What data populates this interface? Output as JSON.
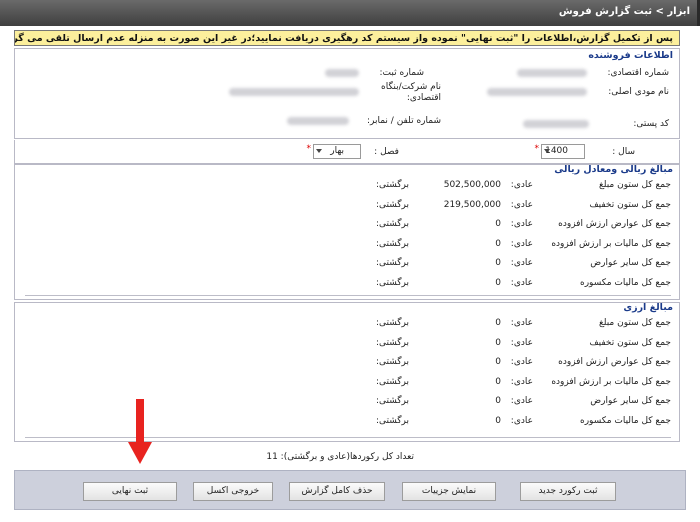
{
  "breadcrumb": "ابزار > ثبت گزارش فروش",
  "notice": "پس از تکمیل گزارش،اطلاعات را \"ثبت نهایی\" نموده واز سیستم کد رهگیری دریافت نمایید؛در غیر این صورت به منزله عدم ارسال تلقی می گردد!",
  "seller": {
    "title": "اطلاعات فروشنده",
    "economic_code_label": "شماره اقتصادی:",
    "reg_no_label": "شماره ثبت:",
    "taxpayer_name_label": "نام مودی اصلی:",
    "company_name_label": "نام شرکت/بنگاه اقتصادی:",
    "postal_code_label": "کد پستی:",
    "phone_label": "شماره تلفن / نمابر:"
  },
  "filters": {
    "year_label": "سال :",
    "year_value": "1400",
    "season_label": "فصل :",
    "season_value": "بهار"
  },
  "rial": {
    "title": "مبالغ ریالی ومعادل ریالی",
    "rows": [
      {
        "label": "جمع کل ستون مبلغ",
        "adi": "عادی:",
        "value": "502,500,000",
        "ret": "برگشتی:"
      },
      {
        "label": "جمع کل ستون تخفیف",
        "adi": "عادی:",
        "value": "219,500,000",
        "ret": "برگشتی:"
      },
      {
        "label": "جمع کل عوارض ارزش افزوده",
        "adi": "عادی:",
        "value": "0",
        "ret": "برگشتی:"
      },
      {
        "label": "جمع کل مالیات بر ارزش افزوده",
        "adi": "عادی:",
        "value": "0",
        "ret": "برگشتی:"
      },
      {
        "label": "جمع کل سایر عوارض",
        "adi": "عادی:",
        "value": "0",
        "ret": "برگشتی:"
      },
      {
        "label": "جمع کل مالیات مکسوره",
        "adi": "عادی:",
        "value": "0",
        "ret": "برگشتی:"
      }
    ]
  },
  "currency": {
    "title": "مبالغ ارزی",
    "rows": [
      {
        "label": "جمع کل ستون مبلغ",
        "adi": "عادی:",
        "value": "0",
        "ret": "برگشتی:"
      },
      {
        "label": "جمع کل ستون تخفیف",
        "adi": "عادی:",
        "value": "0",
        "ret": "برگشتی:"
      },
      {
        "label": "جمع کل عوارض ارزش افزوده",
        "adi": "عادی:",
        "value": "0",
        "ret": "برگشتی:"
      },
      {
        "label": "جمع کل مالیات بر ارزش افزوده",
        "adi": "عادی:",
        "value": "0",
        "ret": "برگشتی:"
      },
      {
        "label": "جمع کل سایر عوارض",
        "adi": "عادی:",
        "value": "0",
        "ret": "برگشتی:"
      },
      {
        "label": "جمع کل مالیات مکسوره",
        "adi": "عادی:",
        "value": "0",
        "ret": "برگشتی:"
      }
    ]
  },
  "record_count": "تعداد کل رکوردها(عادی و برگشتی): 11",
  "buttons": {
    "new_record": "ثبت رکورد جدید",
    "show_details": "نمایش جزییات",
    "delete_report": "حذف کامل گزارش",
    "excel_export": "خروجی اکسل",
    "final_submit": "ثبت نهایی"
  },
  "colors": {
    "accent": "#1a3a8a",
    "notice_bg": "#fcef9c",
    "arrow": "#e8231f",
    "button_bar": "#cdd0dc"
  }
}
